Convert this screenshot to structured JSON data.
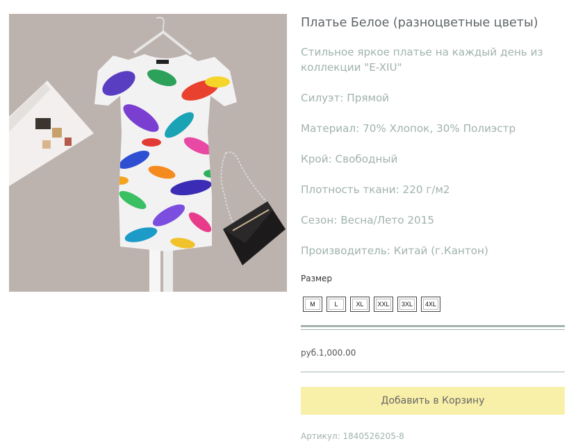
{
  "product": {
    "title": "Платье Белое (разноцветные цветы)",
    "description": [
      "Стильное яркое платье на каждый день из коллекции \"E-XIU\"",
      "Силуэт: Прямой",
      "Материал: 70% Хлопок, 30% Полиэстр",
      "Крой: Свободный",
      "Плотность ткани: 220 г/м2",
      "Сезон: Весна/Лето 2015",
      "Производитель: Китай (г.Кантон)"
    ],
    "size_label": "Размер",
    "sizes": [
      "M",
      "L",
      "XL",
      "XXL",
      "3XL",
      "4XL"
    ],
    "price": "руб.1,000.00",
    "add_to_cart_label": "Добавить в Корзину",
    "sku": "Артикул: 1840526205-8"
  },
  "colors": {
    "title_text": "#5d6366",
    "description_text": "#a0b3ac",
    "add_button_bg": "#f8efa8",
    "rule": "#a4b2ae"
  }
}
